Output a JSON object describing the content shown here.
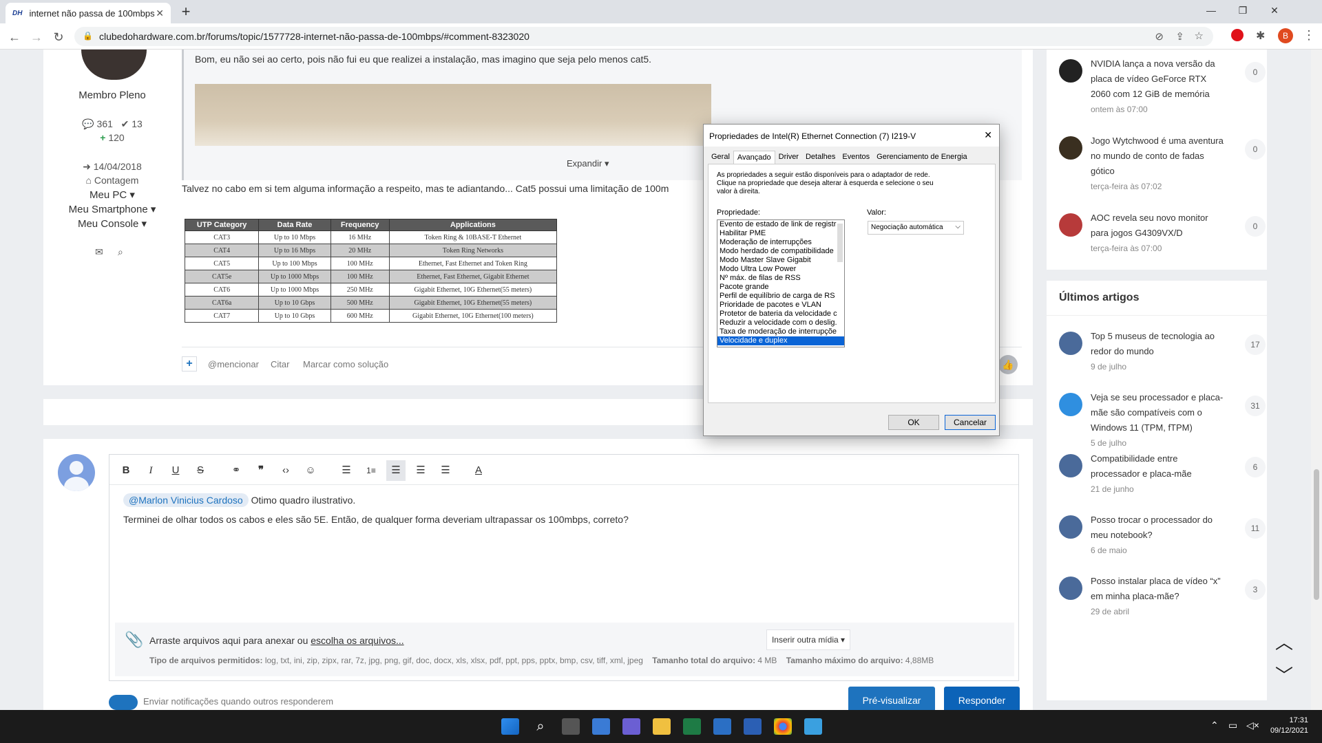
{
  "browser": {
    "tab_title": "internet não passa de 100mbps",
    "tab_favicon": "DH",
    "url": "clubedohardware.com.br/forums/topic/1577728-internet-não-passa-de-100mbps/#comment-8323020",
    "profile_initial": "B"
  },
  "author": {
    "role": "Membro Pleno",
    "posts": "361",
    "solutions": "13",
    "reputation": "120",
    "joined": "14/04/2018",
    "location": "Contagem",
    "pc": "Meu PC",
    "smartphone": "Meu Smartphone",
    "console": "Meu Console"
  },
  "post": {
    "quote_text": "Bom, eu não sei ao certo, pois não fui eu que realizei a instalação, mas imagino que seja pelo menos cat5.",
    "expand": "Expandir",
    "body": "Talvez no cabo em si tem alguma informação a respeito, mas te adiantando... Cat5 possui uma limitação de 100m",
    "mention": "@mencionar",
    "quote": "Citar",
    "solution": "Marcar como solução"
  },
  "utp_table": {
    "headers": [
      "UTP Category",
      "Data Rate",
      "Frequency",
      "Applications"
    ],
    "rows": [
      [
        "CAT3",
        "Up to 10 Mbps",
        "16 MHz",
        "Token Ring & 10BASE-T Ethernet"
      ],
      [
        "CAT4",
        "Up to 16 Mbps",
        "20 MHz",
        "Token Ring Networks"
      ],
      [
        "CAT5",
        "Up to 100 Mbps",
        "100 MHz",
        "Ethernet, Fast Ethernet and Token Ring"
      ],
      [
        "CAT5e",
        "Up to 1000 Mbps",
        "100 MHz",
        "Ethernet, Fast Ethernet, Gigabit Ethernet"
      ],
      [
        "CAT6",
        "Up to 1000 Mbps",
        "250 MHz",
        "Gigabit Ethernet, 10G Ethernet(55 meters)"
      ],
      [
        "CAT6a",
        "Up to 10 Gbps",
        "500 MHz",
        "Gigabit Ethernet, 10G Ethernet(55 meters)"
      ],
      [
        "CAT7",
        "Up to 10 Gbps",
        "600 MHz",
        "Gigabit Ethernet, 10G Ethernet(100 meters)"
      ]
    ]
  },
  "editor": {
    "mention": "@Marlon Vinicius Cardoso",
    "line1": "Otimo quadro ilustrativo.",
    "line2": "Terminei de olhar todos os cabos e eles são 5E. Então, de qualquer forma deveriam ultrapassar os 100mbps, correto?",
    "attach_text": "Arraste arquivos aqui para anexar ou",
    "attach_link": "escolha os arquivos...",
    "insert_media": "Inserir outra mídia",
    "types_label": "Tipo de arquivos permitidos:",
    "types": "log, txt, ini, zip, zipx, rar, 7z, jpg, png, gif, doc, docx, xls, xlsx, pdf, ppt, pps, pptx, bmp, csv, tiff, xml, jpeg",
    "total_label": "Tamanho total do arquivo:",
    "total": "4 MB",
    "max_label": "Tamanho máximo do arquivo:",
    "max": "4,88MB",
    "notify": "Enviar notificações quando outros responderem",
    "preview_btn": "Pré-visualizar",
    "reply_btn": "Responder"
  },
  "sidebar": {
    "news": [
      {
        "title": "NVIDIA lança a nova versão da placa de vídeo GeForce RTX 2060 com 12 GiB de memória",
        "date": "ontem às 07:00",
        "count": "0"
      },
      {
        "title": "Jogo Wytchwood é uma aventura no mundo de conto de fadas gótico",
        "date": "terça-feira às 07:02",
        "count": "0"
      },
      {
        "title": "AOC revela seu novo monitor para jogos G4309VX/D",
        "date": "terça-feira às 07:00",
        "count": "0"
      }
    ],
    "articles_heading": "Últimos artigos",
    "articles": [
      {
        "title": "Top 5 museus de tecnologia ao redor do mundo",
        "date": "9 de julho",
        "count": "17"
      },
      {
        "title": "Veja se seu processador e placa-mãe são compatíveis com o Windows 11 (TPM, fTPM)",
        "date": "5 de julho",
        "count": "31"
      },
      {
        "title": "Compatibilidade entre processador e placa-mãe",
        "date": "21 de junho",
        "count": "6"
      },
      {
        "title": "Posso trocar o processador do meu notebook?",
        "date": "6 de maio",
        "count": "11"
      },
      {
        "title": "Posso instalar placa de vídeo “x” em minha placa-mãe?",
        "date": "29 de abril",
        "count": "3"
      }
    ]
  },
  "dialog": {
    "title": "Propriedades de Intel(R) Ethernet Connection (7) I219-V",
    "tabs": [
      "Geral",
      "Avançado",
      "Driver",
      "Detalhes",
      "Eventos",
      "Gerenciamento de Energia"
    ],
    "description": "As propriedades a seguir estão disponíveis para o adaptador de rede. Clique na propriedade que deseja alterar à esquerda e selecione o seu valor à direita.",
    "property_label": "Propriedade:",
    "value_label": "Valor:",
    "value": "Negociação automática",
    "properties": [
      "Evento de estado de link de registr",
      "Habilitar PME",
      "Moderação de interrupções",
      "Modo herdado de compatibilidade",
      "Modo Master Slave Gigabit",
      "Modo Ultra Low Power",
      "Nº máx. de filas de RSS",
      "Pacote grande",
      "Perfil de equilíbrio de carga de RS",
      "Prioridade de pacotes e VLAN",
      "Protetor de bateria da velocidade c",
      "Reduzir a velocidade com o deslig.",
      "Taxa de moderação de interrupçõe",
      "Velocidade e duplex"
    ],
    "ok": "OK",
    "cancel": "Cancelar"
  },
  "taskbar": {
    "time": "17:31",
    "date": "09/12/2021"
  },
  "colors": {
    "accent": "#1e73be",
    "success": "#2e9d4f",
    "button": "#0c63b8",
    "dialog_selection": "#0a64d6"
  }
}
